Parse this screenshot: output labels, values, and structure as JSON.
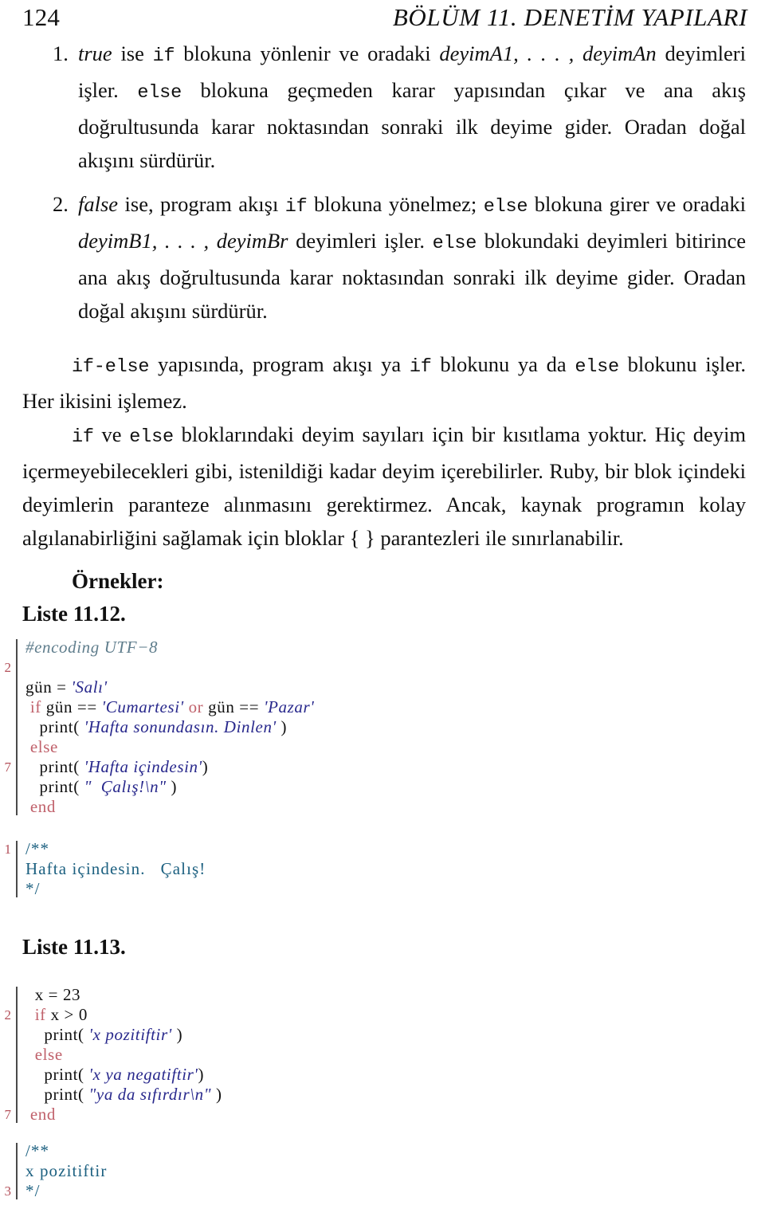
{
  "header": {
    "folio": "124",
    "chapter_title": "BÖLÜM 11.  DENETİM YAPILARI"
  },
  "list": {
    "items": [
      {
        "marker": "1.",
        "parts": [
          {
            "style": "italic",
            "text": "true"
          },
          {
            "style": "roman",
            "text": " ise "
          },
          {
            "style": "tt",
            "text": "if"
          },
          {
            "style": "roman",
            "text": " blokuna yönlenir ve oradaki "
          },
          {
            "style": "italic",
            "text": "deyimA1, . . . , deyimAn"
          },
          {
            "style": "roman",
            "text": " deyimleri işler. "
          },
          {
            "style": "tt",
            "text": "else"
          },
          {
            "style": "roman",
            "text": " blokuna geçmeden karar yapısından çıkar ve ana akış doğrultusunda karar noktasından sonraki ilk deyime gider. Oradan doğal akışını sürdürür."
          }
        ]
      },
      {
        "marker": "2.",
        "parts": [
          {
            "style": "italic",
            "text": "false"
          },
          {
            "style": "roman",
            "text": " ise, program akışı "
          },
          {
            "style": "tt",
            "text": "if"
          },
          {
            "style": "roman",
            "text": " blokuna yönelmez; "
          },
          {
            "style": "tt",
            "text": "else"
          },
          {
            "style": "roman",
            "text": " blokuna girer ve oradaki "
          },
          {
            "style": "italic",
            "text": "deyimB1, . . . , deyimBr"
          },
          {
            "style": "roman",
            "text": " deyimleri işler. "
          },
          {
            "style": "tt",
            "text": "else"
          },
          {
            "style": "roman",
            "text": " blokundaki deyimleri bitirince ana akış doğrultusunda karar noktasından sonraki ilk deyime gider. Oradan doğal akışını sürdürür."
          }
        ]
      }
    ]
  },
  "paragraphs": {
    "p1": {
      "segments": [
        {
          "style": "tt",
          "text": "if-else"
        },
        {
          "style": "roman",
          "text": " yapısında, program akışı ya "
        },
        {
          "style": "tt",
          "text": "if"
        },
        {
          "style": "roman",
          "text": " blokunu ya da "
        },
        {
          "style": "tt",
          "text": "else"
        },
        {
          "style": "roman",
          "text": " blokunu işler. Her ikisini işlemez."
        }
      ]
    },
    "p2": {
      "segments": [
        {
          "style": "tt",
          "text": "if"
        },
        {
          "style": "roman",
          "text": " ve "
        },
        {
          "style": "tt",
          "text": "else"
        },
        {
          "style": "roman",
          "text": " bloklarındaki deyim sayıları için bir kısıtlama yoktur. Hiç deyim içermeyebilecekleri gibi, istenildiği kadar deyim içerebilirler. Ruby, bir blok içindeki deyimlerin paranteze alınmasını gerektirmez. Ancak, kaynak programın kolay algılanabirliğini sağlamak için bloklar { } parantezleri ile sınırlanabilir."
        }
      ]
    }
  },
  "examples_heading": "Örnekler:",
  "listings": [
    {
      "caption": "Liste 11.12.",
      "lines": [
        {
          "lno": "",
          "tokens": [
            {
              "c": "cm",
              "t": "#encoding UTF−8"
            }
          ]
        },
        {
          "lno": "2",
          "tokens": [
            {
              "c": "id",
              "t": ""
            }
          ]
        },
        {
          "lno": "",
          "tokens": [
            {
              "c": "id",
              "t": "gün = "
            },
            {
              "c": "st",
              "t": "'Salı'"
            }
          ]
        },
        {
          "lno": "",
          "tokens": [
            {
              "c": "kw",
              "t": " if"
            },
            {
              "c": "id",
              "t": " gün == "
            },
            {
              "c": "st",
              "t": "'Cumartesi'"
            },
            {
              "c": "kw",
              "t": " or"
            },
            {
              "c": "id",
              "t": " gün == "
            },
            {
              "c": "st",
              "t": "'Pazar'"
            }
          ]
        },
        {
          "lno": "",
          "tokens": [
            {
              "c": "id",
              "t": "   print( "
            },
            {
              "c": "st",
              "t": "'Hafta sonundasın. Dinlen'"
            },
            {
              "c": "id",
              "t": " )"
            }
          ]
        },
        {
          "lno": "",
          "tokens": [
            {
              "c": "kw",
              "t": " else"
            }
          ]
        },
        {
          "lno": "7",
          "tokens": [
            {
              "c": "id",
              "t": "   print( "
            },
            {
              "c": "st",
              "t": "'Hafta içindesin'"
            },
            {
              "c": "id",
              "t": ")"
            }
          ]
        },
        {
          "lno": "",
          "tokens": [
            {
              "c": "id",
              "t": "   print( "
            },
            {
              "c": "st",
              "t": "\"  Çalış!\\n\""
            },
            {
              "c": "id",
              "t": " )"
            }
          ]
        },
        {
          "lno": "",
          "tokens": [
            {
              "c": "kw",
              "t": " end"
            }
          ]
        }
      ],
      "output": {
        "lines": [
          {
            "lno": "1",
            "tokens": [
              {
                "c": "out",
                "t": "/**"
              }
            ]
          },
          {
            "lno": "",
            "tokens": [
              {
                "c": "out",
                "t": "Hafta içindesin.   Çalış!"
              }
            ]
          },
          {
            "lno": "",
            "tokens": [
              {
                "c": "out",
                "t": "*/"
              }
            ]
          }
        ]
      }
    },
    {
      "caption": "Liste 11.13.",
      "lines": [
        {
          "lno": "",
          "tokens": [
            {
              "c": "id",
              "t": "  x = 23"
            }
          ]
        },
        {
          "lno": "2",
          "tokens": [
            {
              "c": "kw",
              "t": "  if"
            },
            {
              "c": "id",
              "t": " x > 0"
            }
          ]
        },
        {
          "lno": "",
          "tokens": [
            {
              "c": "id",
              "t": "    print( "
            },
            {
              "c": "st",
              "t": "'x pozitiftir'"
            },
            {
              "c": "id",
              "t": " )"
            }
          ]
        },
        {
          "lno": "",
          "tokens": [
            {
              "c": "kw",
              "t": "  else"
            }
          ]
        },
        {
          "lno": "",
          "tokens": [
            {
              "c": "id",
              "t": "    print( "
            },
            {
              "c": "st",
              "t": "'x ya negatiftir'"
            },
            {
              "c": "id",
              "t": ")"
            }
          ]
        },
        {
          "lno": "",
          "tokens": [
            {
              "c": "id",
              "t": "    print( "
            },
            {
              "c": "st",
              "t": "\"ya da sıfırdır\\n\""
            },
            {
              "c": "id",
              "t": " )"
            }
          ]
        },
        {
          "lno": "7",
          "tokens": [
            {
              "c": "kw",
              "t": " end"
            }
          ]
        }
      ],
      "output": {
        "lines": [
          {
            "lno": "",
            "tokens": [
              {
                "c": "out",
                "t": "/**"
              }
            ]
          },
          {
            "lno": "",
            "tokens": [
              {
                "c": "out",
                "t": "x pozitiftir"
              }
            ]
          },
          {
            "lno": "3",
            "tokens": [
              {
                "c": "out",
                "t": "*/"
              }
            ]
          }
        ]
      }
    }
  ],
  "colors": {
    "text": "#111111",
    "comment": "#5f7d8c",
    "keyword": "#c0616b",
    "string": "#28288c",
    "output": "#1c6080",
    "linenumber": "#b4505a",
    "rule": "#4a4a4a"
  }
}
